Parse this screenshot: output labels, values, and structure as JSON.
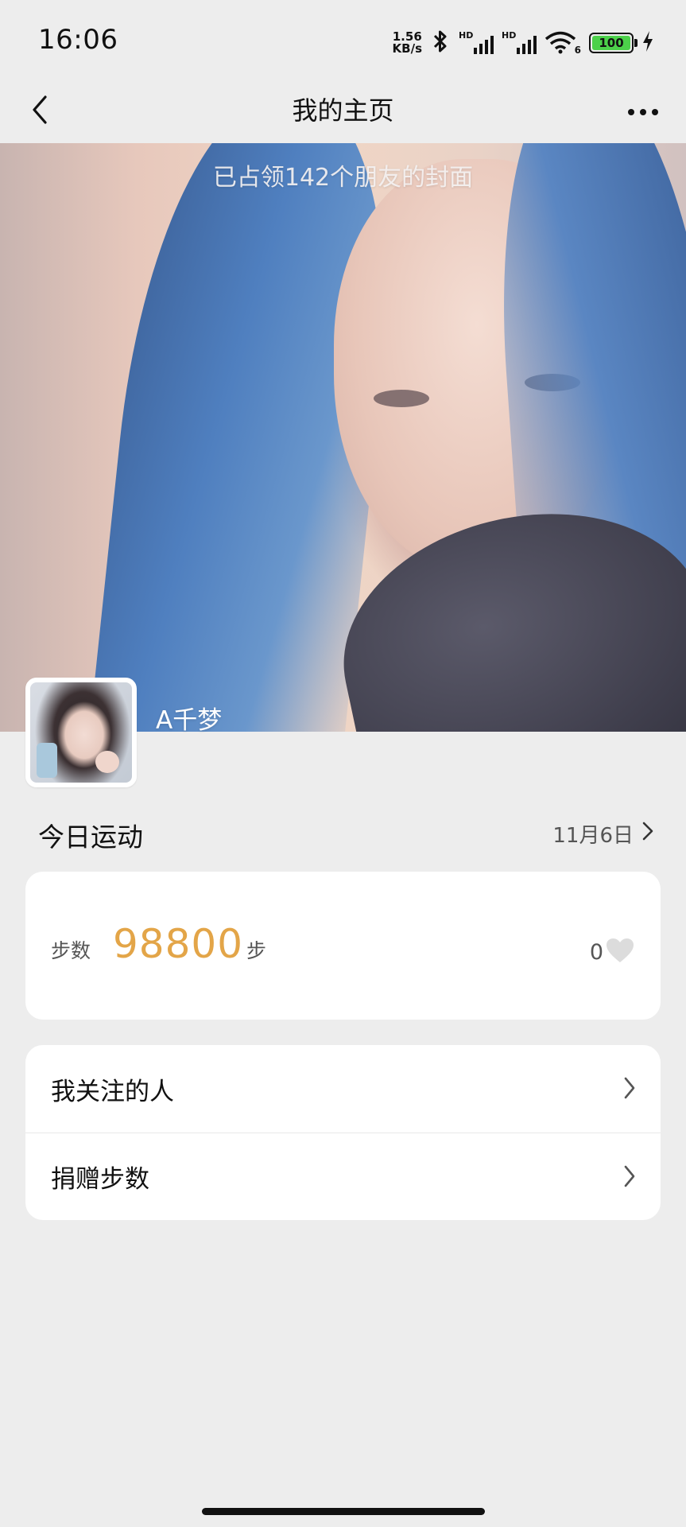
{
  "status_bar": {
    "time": "16:06",
    "net_speed_value": "1.56",
    "net_speed_unit": "KB/s",
    "sim1_label": "HD",
    "sim2_label": "HD",
    "wifi_label": "6",
    "battery_level": "100",
    "icons": [
      "bluetooth-icon",
      "signal-icon",
      "wifi-icon",
      "battery-icon",
      "charging-icon"
    ]
  },
  "nav": {
    "title": "我的主页",
    "back_icon": "chevron-left-icon",
    "more_icon": "more-dots-icon"
  },
  "cover": {
    "caption": "已占领142个朋友的封面"
  },
  "profile": {
    "nickname": "A千梦"
  },
  "today": {
    "title": "今日运动",
    "date": "11月6日"
  },
  "steps": {
    "label": "步数",
    "value": "98800",
    "unit": "步",
    "likes": "0"
  },
  "menu": {
    "items": [
      {
        "label": "我关注的人"
      },
      {
        "label": "捐赠步数"
      }
    ]
  },
  "colors": {
    "background": "#ededed",
    "card": "#ffffff",
    "steps_accent": "#e3a548",
    "battery_fill": "#4cd14a"
  }
}
